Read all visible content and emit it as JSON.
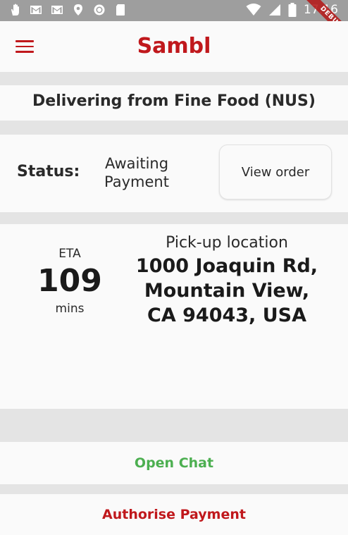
{
  "status_bar": {
    "time": "17:16",
    "left_icons": [
      "hand-icon",
      "gmail-icon",
      "gmail-icon",
      "location-icon",
      "circle-icon",
      "sd-card-icon"
    ],
    "right_icons": [
      "wifi-icon",
      "signal-icon",
      "battery-icon"
    ],
    "debug_banner": "DEBUG"
  },
  "app_bar": {
    "title": "Sambl",
    "menu_icon": "menu-icon",
    "accent_color": "#c0181c"
  },
  "delivering": {
    "text": "Delivering from Fine Food (NUS)"
  },
  "status": {
    "label": "Status:",
    "value": "Awaiting Payment",
    "view_order_label": "View order"
  },
  "pickup": {
    "eta_label": "ETA",
    "eta_value": "109",
    "eta_unit": "mins",
    "location_label": "Pick-up location",
    "address": "1000 Joaquin Rd, Mountain View, CA 94043, USA"
  },
  "actions": {
    "open_chat_label": "Open Chat",
    "open_chat_color": "#4caf50",
    "authorise_payment_label": "Authorise Payment",
    "authorise_payment_color": "#c0181c"
  }
}
